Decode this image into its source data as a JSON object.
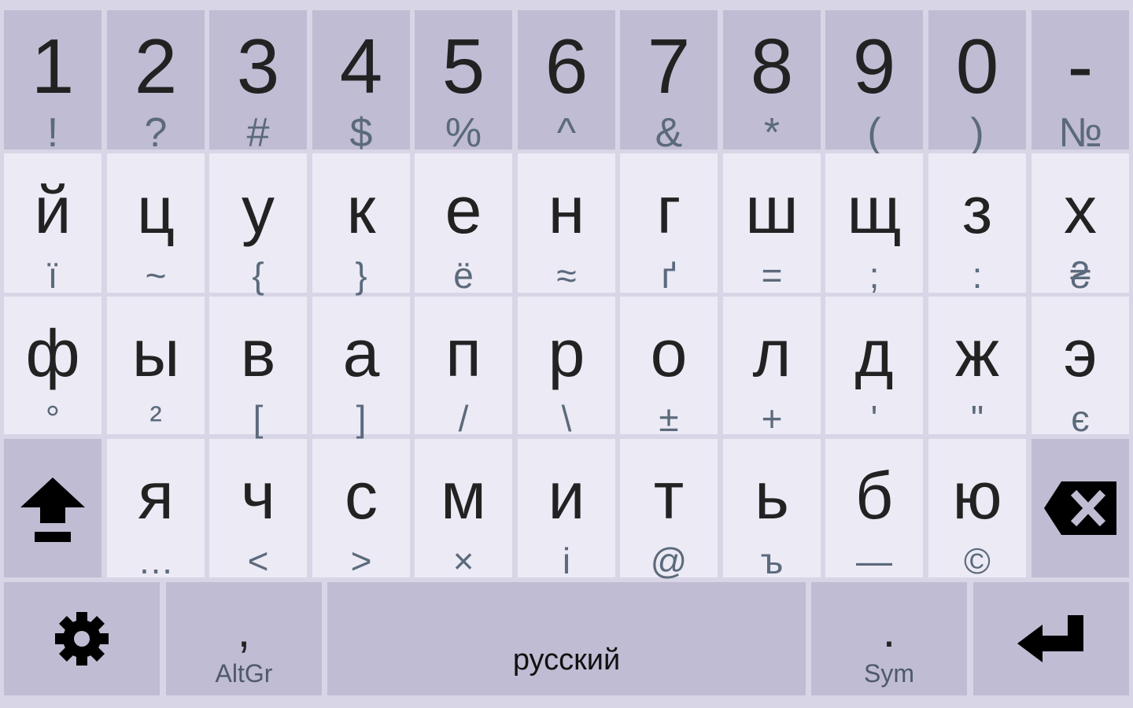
{
  "keyboard": {
    "number_row": [
      {
        "main": "1",
        "sub": "!"
      },
      {
        "main": "2",
        "sub": "?"
      },
      {
        "main": "3",
        "sub": "#"
      },
      {
        "main": "4",
        "sub": "$"
      },
      {
        "main": "5",
        "sub": "%"
      },
      {
        "main": "6",
        "sub": "^"
      },
      {
        "main": "7",
        "sub": "&"
      },
      {
        "main": "8",
        "sub": "*"
      },
      {
        "main": "9",
        "sub": "("
      },
      {
        "main": "0",
        "sub": ")"
      },
      {
        "main": "-",
        "sub": "№"
      }
    ],
    "row1": [
      {
        "main": "й",
        "sub": "ї"
      },
      {
        "main": "ц",
        "sub": "~"
      },
      {
        "main": "у",
        "sub": "{"
      },
      {
        "main": "к",
        "sub": "}"
      },
      {
        "main": "е",
        "sub": "ё"
      },
      {
        "main": "н",
        "sub": "≈"
      },
      {
        "main": "г",
        "sub": "ґ"
      },
      {
        "main": "ш",
        "sub": "="
      },
      {
        "main": "щ",
        "sub": ";"
      },
      {
        "main": "з",
        "sub": ":"
      },
      {
        "main": "х",
        "sub": "₴"
      }
    ],
    "row2": [
      {
        "main": "ф",
        "sub": "°"
      },
      {
        "main": "ы",
        "sub": "²"
      },
      {
        "main": "в",
        "sub": "["
      },
      {
        "main": "а",
        "sub": "]"
      },
      {
        "main": "п",
        "sub": "/"
      },
      {
        "main": "р",
        "sub": "\\"
      },
      {
        "main": "о",
        "sub": "±"
      },
      {
        "main": "л",
        "sub": "+"
      },
      {
        "main": "д",
        "sub": "'"
      },
      {
        "main": "ж",
        "sub": "\""
      },
      {
        "main": "э",
        "sub": "є"
      }
    ],
    "row3": [
      {
        "main": "я",
        "sub": "…"
      },
      {
        "main": "ч",
        "sub": "<"
      },
      {
        "main": "с",
        "sub": ">"
      },
      {
        "main": "м",
        "sub": "×"
      },
      {
        "main": "и",
        "sub": "і"
      },
      {
        "main": "т",
        "sub": "@"
      },
      {
        "main": "ь",
        "sub": "ъ"
      },
      {
        "main": "б",
        "sub": "—"
      },
      {
        "main": "ю",
        "sub": "©"
      }
    ],
    "bottom": {
      "comma_main": ",",
      "comma_sub": "AltGr",
      "space_label": "русский",
      "period_main": ".",
      "period_sub": "Sym"
    },
    "icons": {
      "shift": "shift-icon",
      "backspace": "backspace-icon",
      "settings": "gear-icon",
      "enter": "enter-icon"
    },
    "colors": {
      "background": "#d8d5e6",
      "key_dark": "#c0bcd3",
      "key_light": "#eceaf4",
      "main_text": "#222222",
      "sub_text": "#5b6a7c"
    }
  }
}
